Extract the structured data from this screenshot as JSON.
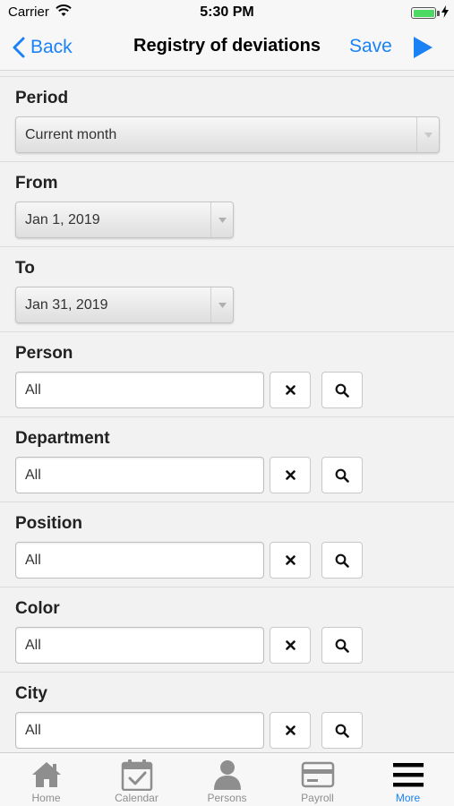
{
  "status_bar": {
    "carrier": "Carrier",
    "time": "5:30 PM"
  },
  "nav": {
    "back_label": "Back",
    "title": "Registry of deviations",
    "save_label": "Save"
  },
  "filters": {
    "period": {
      "label": "Period",
      "value": "Current month"
    },
    "from": {
      "label": "From",
      "value": "Jan 1, 2019"
    },
    "to": {
      "label": "To",
      "value": "Jan 31, 2019"
    },
    "person": {
      "label": "Person",
      "value": "All"
    },
    "department": {
      "label": "Department",
      "value": "All"
    },
    "position": {
      "label": "Position",
      "value": "All"
    },
    "color": {
      "label": "Color",
      "value": "All"
    },
    "city": {
      "label": "City",
      "value": "All"
    }
  },
  "tabbar": {
    "active": "More",
    "items": [
      {
        "label": "Home",
        "icon": "home-icon"
      },
      {
        "label": "Calendar",
        "icon": "calendar-icon"
      },
      {
        "label": "Persons",
        "icon": "person-icon"
      },
      {
        "label": "Payroll",
        "icon": "card-icon"
      },
      {
        "label": "More",
        "icon": "menu-icon"
      }
    ]
  },
  "colors": {
    "accent": "#1a82f5",
    "inactive": "#8e8e8e",
    "battery": "#4cd964"
  }
}
